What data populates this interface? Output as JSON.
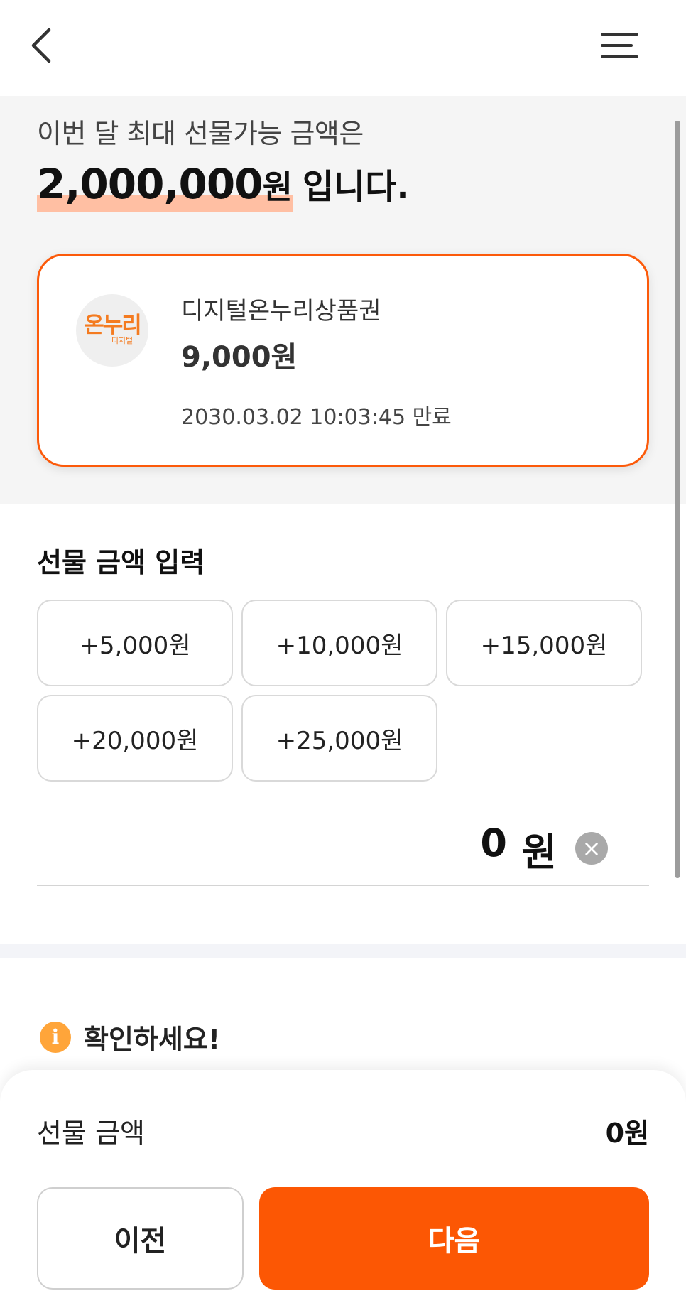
{
  "summary": {
    "intro": "이번 달 최대 선물가능 금액은",
    "max_amount": "2,000,000",
    "max_amount_unit": "원",
    "suffix": "입니다."
  },
  "voucher": {
    "logo_text": "온누리",
    "logo_subtext": "디지털",
    "name": "디지털온누리상품권",
    "balance": "9,000원",
    "expiry": "2030.03.02 10:03:45 만료"
  },
  "gift_input": {
    "title": "선물 금액 입력",
    "quick_amounts": [
      "+5,000원",
      "+10,000원",
      "+15,000원",
      "+20,000원",
      "+25,000원"
    ],
    "current_value": "0",
    "unit": "원",
    "clear_symbol": "×"
  },
  "notice": {
    "icon": "i",
    "text": "확인하세요!"
  },
  "bottom": {
    "total_label": "선물 금액",
    "total_value": "0원",
    "prev_label": "이전",
    "next_label": "다음"
  },
  "icons": {
    "back": "chevron-left-icon",
    "menu": "hamburger-menu-icon",
    "clear": "clear-circle-icon",
    "info": "info-icon"
  },
  "colors": {
    "accent": "#fc5704",
    "card_border": "#fc5a0a",
    "highlight": "#ffbfa3",
    "info_icon": "#ffa53a",
    "summary_bg": "#f5f5f5"
  }
}
